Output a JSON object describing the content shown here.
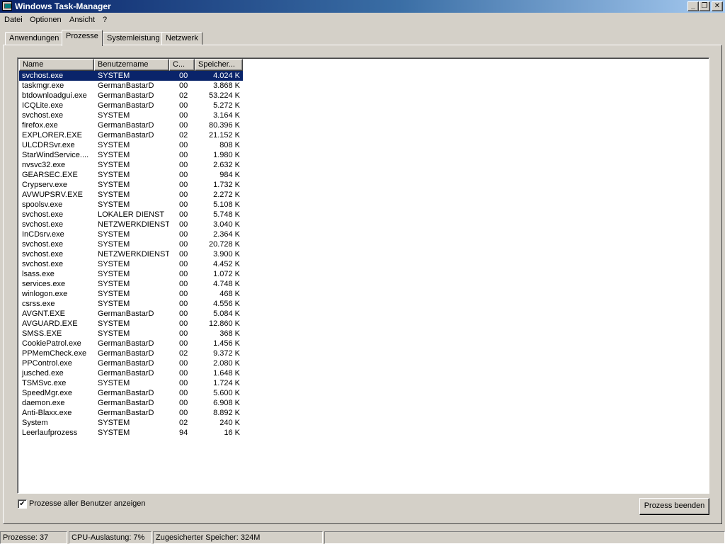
{
  "window": {
    "title": "Windows Task-Manager",
    "title_icon": "task-manager-icon",
    "buttons": {
      "minimize": "_",
      "maximize": "❐",
      "close": "✕"
    }
  },
  "menu": {
    "items": [
      "Datei",
      "Optionen",
      "Ansicht",
      "?"
    ]
  },
  "tabs": {
    "items": [
      "Anwendungen",
      "Prozesse",
      "Systemleistung",
      "Netzwerk"
    ],
    "active": "Prozesse"
  },
  "processes": {
    "columns": [
      "Name",
      "Benutzername",
      "C...",
      "Speicher..."
    ],
    "selected_index": 0,
    "rows": [
      {
        "name": "svchost.exe",
        "user": "SYSTEM",
        "cpu": "00",
        "mem": "4.024 K"
      },
      {
        "name": "taskmgr.exe",
        "user": "GermanBastarD",
        "cpu": "00",
        "mem": "3.868 K"
      },
      {
        "name": "btdownloadgui.exe",
        "user": "GermanBastarD",
        "cpu": "02",
        "mem": "53.224 K"
      },
      {
        "name": "ICQLite.exe",
        "user": "GermanBastarD",
        "cpu": "00",
        "mem": "5.272 K"
      },
      {
        "name": "svchost.exe",
        "user": "SYSTEM",
        "cpu": "00",
        "mem": "3.164 K"
      },
      {
        "name": "firefox.exe",
        "user": "GermanBastarD",
        "cpu": "00",
        "mem": "80.396 K"
      },
      {
        "name": "EXPLORER.EXE",
        "user": "GermanBastarD",
        "cpu": "02",
        "mem": "21.152 K"
      },
      {
        "name": "ULCDRSvr.exe",
        "user": "SYSTEM",
        "cpu": "00",
        "mem": "808 K"
      },
      {
        "name": "StarWindService....",
        "user": "SYSTEM",
        "cpu": "00",
        "mem": "1.980 K"
      },
      {
        "name": "nvsvc32.exe",
        "user": "SYSTEM",
        "cpu": "00",
        "mem": "2.632 K"
      },
      {
        "name": "GEARSEC.EXE",
        "user": "SYSTEM",
        "cpu": "00",
        "mem": "984 K"
      },
      {
        "name": "Crypserv.exe",
        "user": "SYSTEM",
        "cpu": "00",
        "mem": "1.732 K"
      },
      {
        "name": "AVWUPSRV.EXE",
        "user": "SYSTEM",
        "cpu": "00",
        "mem": "2.272 K"
      },
      {
        "name": "spoolsv.exe",
        "user": "SYSTEM",
        "cpu": "00",
        "mem": "5.108 K"
      },
      {
        "name": "svchost.exe",
        "user": "LOKALER DIENST",
        "cpu": "00",
        "mem": "5.748 K"
      },
      {
        "name": "svchost.exe",
        "user": "NETZWERKDIENST",
        "cpu": "00",
        "mem": "3.040 K"
      },
      {
        "name": "InCDsrv.exe",
        "user": "SYSTEM",
        "cpu": "00",
        "mem": "2.364 K"
      },
      {
        "name": "svchost.exe",
        "user": "SYSTEM",
        "cpu": "00",
        "mem": "20.728 K"
      },
      {
        "name": "svchost.exe",
        "user": "NETZWERKDIENST",
        "cpu": "00",
        "mem": "3.900 K"
      },
      {
        "name": "svchost.exe",
        "user": "SYSTEM",
        "cpu": "00",
        "mem": "4.452 K"
      },
      {
        "name": "lsass.exe",
        "user": "SYSTEM",
        "cpu": "00",
        "mem": "1.072 K"
      },
      {
        "name": "services.exe",
        "user": "SYSTEM",
        "cpu": "00",
        "mem": "4.748 K"
      },
      {
        "name": "winlogon.exe",
        "user": "SYSTEM",
        "cpu": "00",
        "mem": "468 K"
      },
      {
        "name": "csrss.exe",
        "user": "SYSTEM",
        "cpu": "00",
        "mem": "4.556 K"
      },
      {
        "name": "AVGNT.EXE",
        "user": "GermanBastarD",
        "cpu": "00",
        "mem": "5.084 K"
      },
      {
        "name": "AVGUARD.EXE",
        "user": "SYSTEM",
        "cpu": "00",
        "mem": "12.860 K"
      },
      {
        "name": "SMSS.EXE",
        "user": "SYSTEM",
        "cpu": "00",
        "mem": "368 K"
      },
      {
        "name": "CookiePatrol.exe",
        "user": "GermanBastarD",
        "cpu": "00",
        "mem": "1.456 K"
      },
      {
        "name": "PPMemCheck.exe",
        "user": "GermanBastarD",
        "cpu": "02",
        "mem": "9.372 K"
      },
      {
        "name": "PPControl.exe",
        "user": "GermanBastarD",
        "cpu": "00",
        "mem": "2.080 K"
      },
      {
        "name": "jusched.exe",
        "user": "GermanBastarD",
        "cpu": "00",
        "mem": "1.648 K"
      },
      {
        "name": "TSMSvc.exe",
        "user": "SYSTEM",
        "cpu": "00",
        "mem": "1.724 K"
      },
      {
        "name": "SpeedMgr.exe",
        "user": "GermanBastarD",
        "cpu": "00",
        "mem": "5.600 K"
      },
      {
        "name": "daemon.exe",
        "user": "GermanBastarD",
        "cpu": "00",
        "mem": "6.908 K"
      },
      {
        "name": "Anti-Blaxx.exe",
        "user": "GermanBastarD",
        "cpu": "00",
        "mem": "8.892 K"
      },
      {
        "name": "System",
        "user": "SYSTEM",
        "cpu": "02",
        "mem": "240 K"
      },
      {
        "name": "Leerlaufprozess",
        "user": "SYSTEM",
        "cpu": "94",
        "mem": "16 K"
      }
    ]
  },
  "controls": {
    "show_all_users_label": "Prozesse aller Benutzer anzeigen",
    "show_all_users_checked": true,
    "end_process_label": "Prozess beenden"
  },
  "status": {
    "processes": "Prozesse: 37",
    "cpu": "CPU-Auslastung: 7%",
    "memory": "Zugesicherter Speicher: 324M"
  },
  "colors": {
    "titlebar_start": "#0a246a",
    "titlebar_end": "#a6caf0",
    "selection": "#0a246a",
    "face": "#d4d0c8"
  }
}
